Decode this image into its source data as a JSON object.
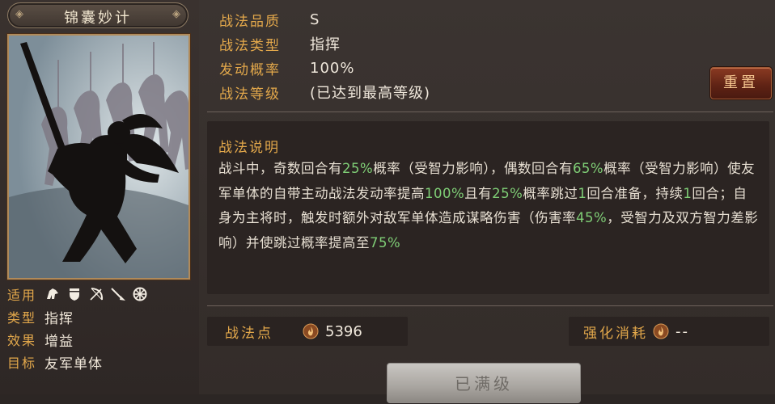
{
  "skill": {
    "name": "锦囊妙计"
  },
  "attributes": {
    "applicable": {
      "key": "适用",
      "units": [
        "cavalry-icon",
        "shield-icon",
        "bow-icon",
        "spear-icon",
        "chariot-wheel-icon"
      ]
    },
    "type": {
      "key": "类型",
      "value": "指挥"
    },
    "effect": {
      "key": "效果",
      "value": "增益"
    },
    "target": {
      "key": "目标",
      "value": "友军单体"
    }
  },
  "info": {
    "quality": {
      "key": "战法品质",
      "value": "S"
    },
    "kind": {
      "key": "战法类型",
      "value": "指挥"
    },
    "rate": {
      "key": "发动概率",
      "value": "100%"
    },
    "level": {
      "key": "战法等级",
      "value": "(已达到最高等级)"
    }
  },
  "reset_label": "重置",
  "description": {
    "title": "战法说明",
    "segments": [
      {
        "text": "战斗中，奇数回合有",
        "hl": false
      },
      {
        "text": "25%",
        "hl": true
      },
      {
        "text": "概率（受智力影响），偶数回合有",
        "hl": false
      },
      {
        "text": "65%",
        "hl": true
      },
      {
        "text": "概率（受智力影响）使友军单体的自带主动战法发动率提高",
        "hl": false
      },
      {
        "text": "100%",
        "hl": true
      },
      {
        "text": "且有",
        "hl": false
      },
      {
        "text": "25%",
        "hl": true
      },
      {
        "text": "概率跳过",
        "hl": false
      },
      {
        "text": "1",
        "hl": true
      },
      {
        "text": "回合准备，持续",
        "hl": false
      },
      {
        "text": "1",
        "hl": true
      },
      {
        "text": "回合；自身为主将时，触发时额外对敌军单体造成谋略伤害（伤害率",
        "hl": false
      },
      {
        "text": "45%",
        "hl": true
      },
      {
        "text": "，受智力及双方智力差影响）并使跳过概率提高至",
        "hl": false
      },
      {
        "text": "75%",
        "hl": true
      }
    ]
  },
  "points": {
    "label": "战法点",
    "icon": "flame-icon",
    "value": "5396"
  },
  "cost": {
    "label": "强化消耗",
    "icon": "flame-icon",
    "value": "--"
  },
  "max_button_label": "已满级",
  "colors": {
    "accent_gold": "#e3a84b",
    "highlight_green": "#7fce76",
    "reset_red": "#5e2214"
  }
}
